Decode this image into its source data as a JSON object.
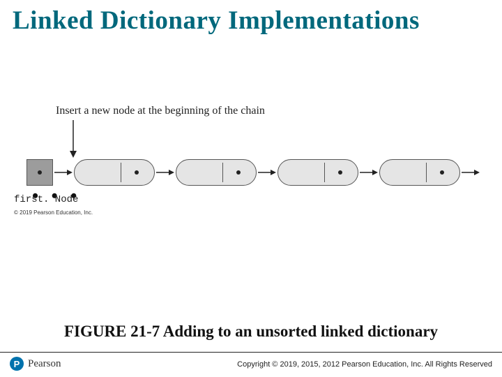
{
  "title": "Linked Dictionary Implementations",
  "figure": {
    "insert_label": "Insert a new node at the beginning of the chain",
    "first_node_label": "first. Node",
    "inner_copyright": "© 2019 Pearson Education, Inc.",
    "ellipsis": "• • •"
  },
  "caption": "FIGURE 21-7 Adding to an unsorted linked dictionary",
  "footer": {
    "logo_letter": "P",
    "logo_text": "Pearson",
    "copyright": "Copyright © 2019, 2015, 2012 Pearson Education, Inc. All Rights Reserved"
  }
}
